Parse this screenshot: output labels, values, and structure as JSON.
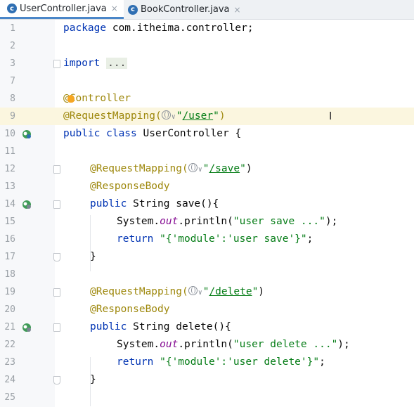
{
  "tabs": [
    {
      "label": "UserController.java",
      "icon": "class-c-icon",
      "active": true
    },
    {
      "label": "BookController.java",
      "icon": "class-c-icon",
      "active": false
    }
  ],
  "lines": [
    {
      "num": "1"
    },
    {
      "num": "2"
    },
    {
      "num": "3"
    },
    {
      "num": "7"
    },
    {
      "num": "8"
    },
    {
      "num": "9"
    },
    {
      "num": "10"
    },
    {
      "num": "11"
    },
    {
      "num": "12"
    },
    {
      "num": "13"
    },
    {
      "num": "14"
    },
    {
      "num": "15"
    },
    {
      "num": "16"
    },
    {
      "num": "17"
    },
    {
      "num": "18"
    },
    {
      "num": "19"
    },
    {
      "num": "20"
    },
    {
      "num": "21"
    },
    {
      "num": "22"
    },
    {
      "num": "23"
    },
    {
      "num": "24"
    },
    {
      "num": "25"
    }
  ],
  "code": {
    "l1_kw": "package",
    "l1_rest": " com.itheima.controller;",
    "l3_kw": "import",
    "l3_dots": "...",
    "l8_a": "@",
    "l8_b": "Controller",
    "l9_ann": "@RequestMapping(",
    "l9_str": "\"",
    "l9_path": "/user",
    "l9_end": "\"",
    "l9_close": ")",
    "l10_kw": "public class",
    "l10_rest": " UserController {",
    "l12_ann": "@RequestMapping(",
    "l12_str": "\"",
    "l12_path": "/save",
    "l12_end": "\"",
    "l12_close": ")",
    "l13_ann": "@ResponseBody",
    "l14_kw": "public",
    "l14_rest": " String save(){",
    "l15_a": "System.",
    "l15_fld": "out",
    "l15_b": ".println(",
    "l15_str": "\"user save ...\"",
    "l15_c": ");",
    "l16_kw": "return",
    "l16_str": " \"{'module':'user save'}\"",
    "l16_c": ";",
    "l17": "}",
    "l19_ann": "@RequestMapping(",
    "l19_str": "\"",
    "l19_path": "/delete",
    "l19_end": "\"",
    "l19_close": ")",
    "l20_ann": "@ResponseBody",
    "l21_kw": "public",
    "l21_rest": " String delete(){",
    "l22_a": "System.",
    "l22_fld": "out",
    "l22_b": ".println(",
    "l22_str": "\"user delete ...\"",
    "l22_c": ");",
    "l23_kw": "return",
    "l23_str": " \"{'module':'user delete'}\"",
    "l23_c": ";",
    "l24": "}"
  },
  "colors": {
    "keyword": "#0033b3",
    "annotation": "#9e880d",
    "string": "#067d17",
    "field": "#871094",
    "highlight": "#fbf6df"
  }
}
